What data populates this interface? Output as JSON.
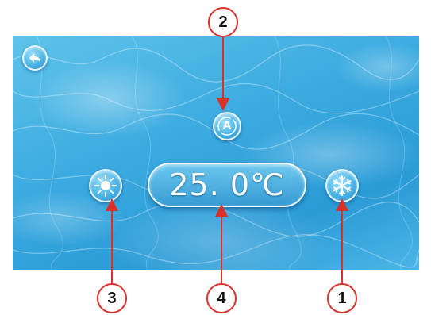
{
  "caption": "",
  "screen": {
    "back_button": {
      "icon": "back-arrow-icon"
    },
    "auto_button": {
      "label": "A",
      "icon": "auto-mode-icon"
    },
    "heat_button": {
      "icon": "sun-icon"
    },
    "cool_button": {
      "icon": "snowflake-icon"
    },
    "temperature": "25. 0℃"
  },
  "callouts": [
    {
      "number": "2",
      "target": "auto-mode-button"
    },
    {
      "number": "3",
      "target": "heat-mode-button"
    },
    {
      "number": "4",
      "target": "temperature-display"
    },
    {
      "number": "1",
      "target": "cool-mode-button"
    }
  ],
  "colors": {
    "callout_red": "#d9302a",
    "water_blue": "#39a9df",
    "button_white": "#ffffff"
  }
}
